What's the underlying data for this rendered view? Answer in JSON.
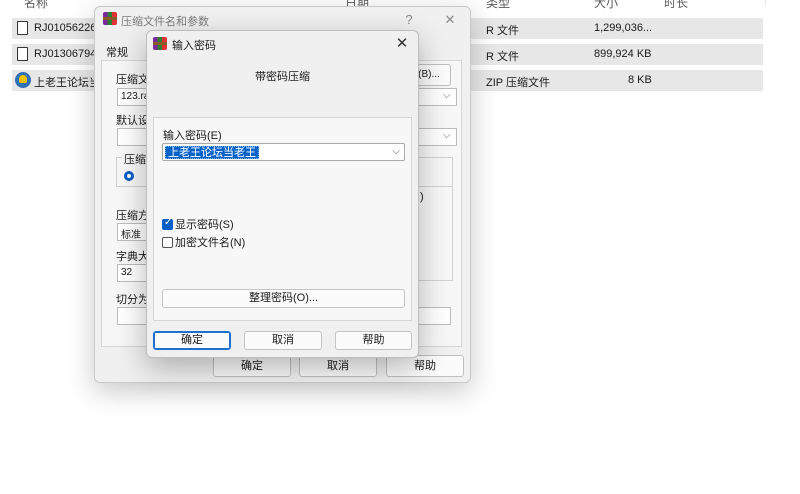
{
  "file_list": {
    "headers": [
      "名称",
      "日期",
      "类型",
      "大小",
      "时长"
    ],
    "rows": [
      {
        "name": "RJ01056226",
        "type": "R 文件",
        "size": "1,299,036...",
        "icon": "file-icon"
      },
      {
        "name": "RJ01306794",
        "type": "R 文件",
        "size": "899,924 KB",
        "icon": "file-icon"
      },
      {
        "name": "上老王论坛当",
        "type": "ZIP 压缩文件",
        "size": "8 KB",
        "icon": "zip-archive-icon"
      }
    ]
  },
  "outer_dialog": {
    "title": "压缩文件名和参数",
    "help_glyph": "?",
    "close_glyph": "✕",
    "tab": "常规",
    "archive_name_label": "压缩文",
    "archive_name_value": "123.ra",
    "browse_label": "(B)...",
    "default_label": "默认设",
    "format_group_label": "压缩",
    "method_label": "压缩方",
    "method_value": "标准",
    "dict_label": "字典大",
    "dict_value": "32",
    "split_label": "切分为",
    "right_paren": ")",
    "ok": "确定",
    "cancel": "取消",
    "help": "帮助"
  },
  "password_dialog": {
    "title": "输入密码",
    "close_glyph": "✕",
    "subtitle": "带密码压缩",
    "password_label": "输入密码(E)",
    "password_value": "上老王论坛当老王",
    "show_password_label": "显示密码(S)",
    "show_password_checked": true,
    "encrypt_names_label": "加密文件名(N)",
    "encrypt_names_checked": false,
    "manage_button": "整理密码(O)...",
    "ok": "确定",
    "cancel": "取消",
    "help": "帮助"
  }
}
